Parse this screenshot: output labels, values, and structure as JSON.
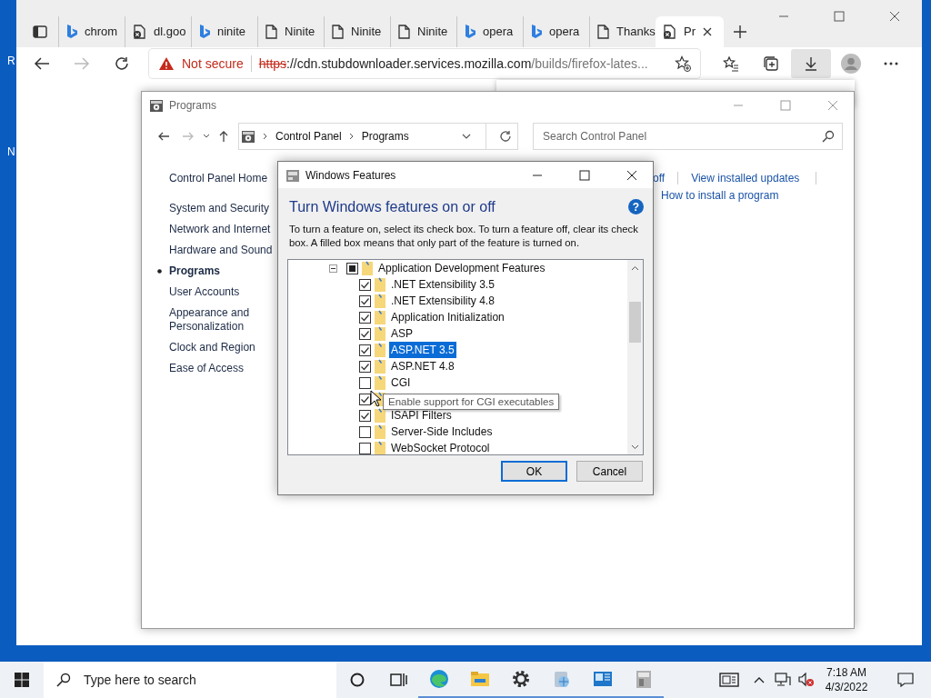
{
  "desktop": {
    "icon_labels": [
      "R",
      "N"
    ]
  },
  "browser": {
    "tabs": [
      {
        "kind": "bing",
        "label": "chrom",
        "selected": false
      },
      {
        "kind": "error",
        "label": "dl.goo",
        "selected": false
      },
      {
        "kind": "bing",
        "label": "ninite",
        "selected": false
      },
      {
        "kind": "page",
        "label": "Ninite",
        "selected": false
      },
      {
        "kind": "page",
        "label": "Ninite",
        "selected": false
      },
      {
        "kind": "page",
        "label": "Ninite",
        "selected": false
      },
      {
        "kind": "bing",
        "label": "opera",
        "selected": false
      },
      {
        "kind": "bing",
        "label": "opera",
        "selected": false
      },
      {
        "kind": "page",
        "label": "Thanks",
        "selected": false
      },
      {
        "kind": "error",
        "label": "Pr",
        "selected": true
      }
    ],
    "security": "Not secure",
    "url": {
      "scheme": "https",
      "host": "://cdn.stubdownloader.services.mozilla.com",
      "path": "/builds/firefox-lates..."
    }
  },
  "programs_window": {
    "title": "Programs",
    "breadcrumb": [
      "Control Panel",
      "Programs"
    ],
    "search": {
      "placeholder": "Search Control Panel"
    },
    "home_link": "Control Panel Home",
    "sidebar": {
      "items": [
        {
          "label": "System and Security",
          "selected": false
        },
        {
          "label": "Network and Internet",
          "selected": false
        },
        {
          "label": "Hardware and Sound",
          "selected": false
        },
        {
          "label": "Programs",
          "selected": true
        },
        {
          "label": "User Accounts",
          "selected": false
        },
        {
          "label": "Appearance and Personalization",
          "selected": false
        },
        {
          "label": "Clock and Region",
          "selected": false
        },
        {
          "label": "Ease of Access",
          "selected": false
        }
      ]
    },
    "links": [
      "off",
      "View installed updates",
      "How to install a program"
    ]
  },
  "dialog": {
    "title": "Windows Features",
    "heading": "Turn Windows features on or off",
    "help": "?",
    "description": "To turn a feature on, select its check box. To turn a feature off, clear its check box. A filled box means that only part of the feature is turned on.",
    "tree": [
      {
        "label": "Application Development Features",
        "expanded": true,
        "partial": true,
        "selected": false,
        "children": [
          {
            "label": ".NET Extensibility 3.5",
            "checked": true,
            "selected": false
          },
          {
            "label": ".NET Extensibility 4.8",
            "checked": true,
            "selected": false
          },
          {
            "label": "Application Initialization",
            "checked": true,
            "selected": false
          },
          {
            "label": "ASP",
            "checked": true,
            "selected": false
          },
          {
            "label": "ASP.NET 3.5",
            "checked": true,
            "selected": true
          },
          {
            "label": "ASP.NET 4.8",
            "checked": true,
            "selected": false
          },
          {
            "label": "CGI",
            "checked": false,
            "selected": false
          },
          {
            "checked": true,
            "selected": false
          },
          {
            "label": "ISAPI Filters",
            "checked": true,
            "selected": false
          },
          {
            "label": "Server-Side Includes",
            "checked": false,
            "selected": false
          },
          {
            "label": "WebSocket Protocol",
            "checked": false,
            "selected": false
          }
        ]
      }
    ],
    "tooltip": "Enable support for CGI executables",
    "buttons": [
      {
        "label": "OK",
        "default": true
      },
      {
        "label": "Cancel",
        "default": false
      }
    ]
  },
  "taskbar": {
    "search": {
      "placeholder": "Type here to search"
    },
    "apps": [
      {
        "running": false
      },
      {
        "running": false
      },
      {
        "running": true
      },
      {
        "running": true
      },
      {
        "running": true
      },
      {
        "running": true
      },
      {
        "running": true
      },
      {
        "running": true
      }
    ],
    "time": "7:18 AM",
    "date": "4/3/2022"
  }
}
